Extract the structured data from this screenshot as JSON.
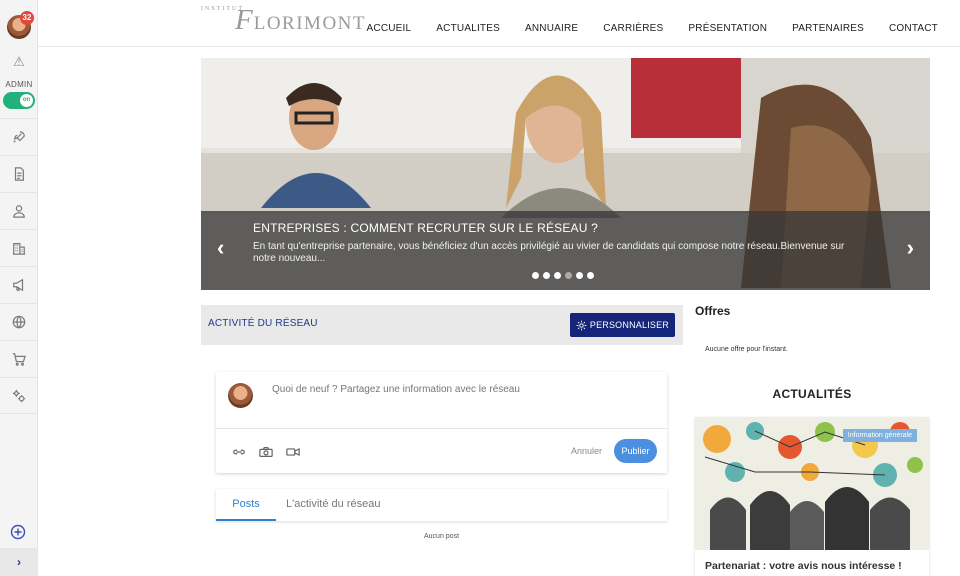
{
  "rail": {
    "badge_count": "32",
    "admin_label": "ADMIN",
    "toggle_label": "on",
    "items": [
      {
        "icon": "rocket-icon"
      },
      {
        "icon": "document-icon"
      },
      {
        "icon": "user-icon"
      },
      {
        "icon": "building-icon"
      },
      {
        "icon": "megaphone-icon"
      },
      {
        "icon": "globe-icon"
      },
      {
        "icon": "cart-icon"
      },
      {
        "icon": "settings-icon"
      }
    ],
    "expand_label": "›"
  },
  "header": {
    "logo_small": "INSTITUT",
    "logo_initial": "F",
    "logo_rest": "LORIMONT",
    "nav": [
      "ACCUEIL",
      "ACTUALITES",
      "ANNUAIRE",
      "CARRIÈRES",
      "PRÉSENTATION",
      "PARTENAIRES",
      "CONTACT"
    ]
  },
  "hero": {
    "title": "ENTREPRISES : COMMENT RECRUTER SUR LE RÉSEAU ?",
    "text": "En tant qu'entreprise partenaire, vous bénéficiez d'un accès privilégié au vivier de candidats qui compose notre réseau.Bienvenue sur notre nouveau...",
    "prev_label": "‹",
    "next_label": "›",
    "slide_count": 6,
    "active_slide": 4
  },
  "activity": {
    "title": "ACTIVITÉ DU RÉSEAU",
    "personalize_label": "PERSONNALISER"
  },
  "composer": {
    "placeholder": "Quoi de neuf ? Partagez une information avec le réseau",
    "cancel_label": "Annuler",
    "publish_label": "Publier"
  },
  "tabs": {
    "posts": "Posts",
    "network": "L'activité du réseau",
    "empty": "Aucun post"
  },
  "offers": {
    "title": "Offres",
    "empty": "Aucune offre pour l'instant."
  },
  "news": {
    "title": "ACTUALITÉS",
    "tag": "Information générale",
    "headline": "Partenariat : votre avis nous intéresse !"
  },
  "colors": {
    "brand_navy": "#15267a",
    "accent_blue": "#4a8fe0",
    "toggle_green": "#22b07d",
    "badge_red": "#e2473a"
  }
}
